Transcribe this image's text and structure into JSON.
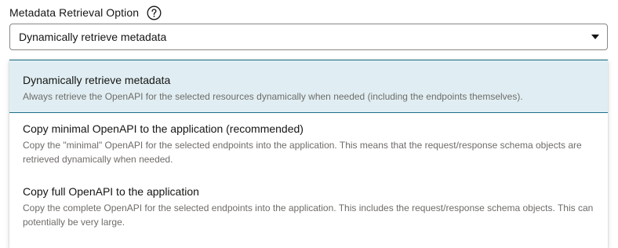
{
  "field": {
    "label": "Metadata Retrieval Option",
    "help_icon": "question-circle-icon",
    "selected_value": "Dynamically retrieve metadata",
    "caret_icon": "caret-down-icon"
  },
  "options": [
    {
      "title": "Dynamically retrieve metadata",
      "description": "Always retrieve the OpenAPI for the selected resources dynamically when needed (including the endpoints themselves).",
      "selected": true
    },
    {
      "title": "Copy minimal OpenAPI to the application (recommended)",
      "description": "Copy the \"minimal\" OpenAPI for the selected endpoints into the application. This means that the request/response schema objects are retrieved dynamically when needed.",
      "selected": false
    },
    {
      "title": "Copy full OpenAPI to the application",
      "description": "Copy the complete OpenAPI for the selected endpoints into the application. This includes the request/response schema objects. This can potentially be very large.",
      "selected": false
    }
  ],
  "colors": {
    "selected_bg": "#e0eef3",
    "selected_border": "#1f6f87",
    "description_text": "#6f6c69"
  }
}
